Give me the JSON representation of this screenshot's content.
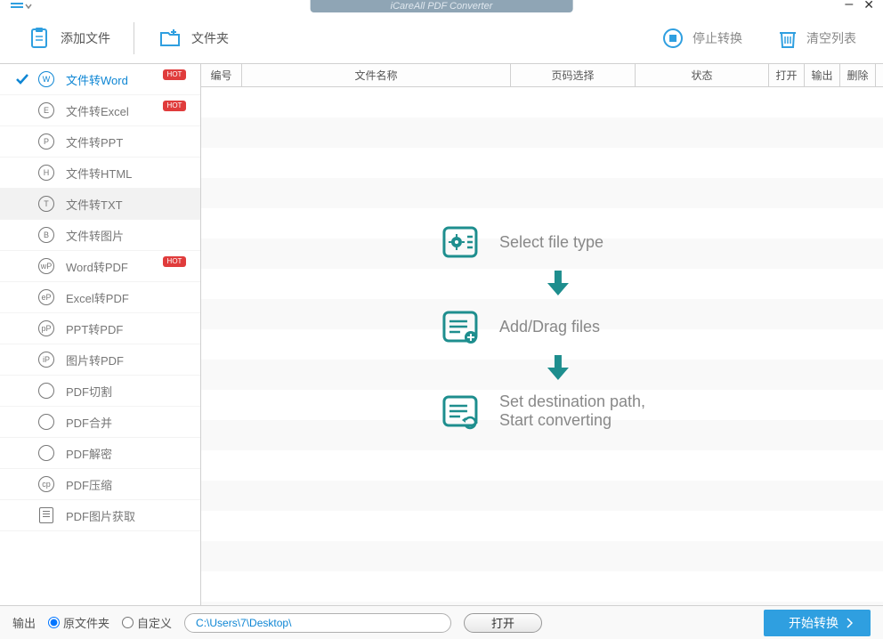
{
  "app": {
    "title": "iCareAll PDF Converter"
  },
  "toolbar": {
    "add_file": "添加文件",
    "add_folder": "文件夹",
    "stop": "停止转换",
    "clear": "清空列表"
  },
  "sidebar": {
    "items": [
      {
        "icon": "W",
        "label": "文件转Word",
        "hot": true,
        "active": true
      },
      {
        "icon": "E",
        "label": "文件转Excel",
        "hot": true
      },
      {
        "icon": "P",
        "label": "文件转PPT"
      },
      {
        "icon": "H",
        "label": "文件转HTML"
      },
      {
        "icon": "T",
        "label": "文件转TXT",
        "hover": true
      },
      {
        "icon": "B",
        "label": "文件转图片"
      },
      {
        "icon": "wP",
        "label": "Word转PDF",
        "hot": true
      },
      {
        "icon": "eP",
        "label": "Excel转PDF"
      },
      {
        "icon": "pP",
        "label": "PPT转PDF"
      },
      {
        "icon": "iP",
        "label": "图片转PDF"
      },
      {
        "icon": "cut",
        "label": "PDF切割"
      },
      {
        "icon": "mer",
        "label": "PDF合并"
      },
      {
        "icon": "dec",
        "label": "PDF解密"
      },
      {
        "icon": "cp",
        "label": "PDF压缩"
      },
      {
        "icon": "img",
        "label": "PDF图片获取"
      }
    ]
  },
  "table": {
    "columns": {
      "num": "编号",
      "name": "文件名称",
      "page": "页码选择",
      "status": "状态",
      "open": "打开",
      "out": "输出",
      "del": "删除"
    }
  },
  "placeholder": {
    "step1": "Select file type",
    "step2": "Add/Drag files",
    "step3a": "Set destination path,",
    "step3b": "Start converting"
  },
  "footer": {
    "output_label": "输出",
    "radio_src": "原文件夹",
    "radio_custom": "自定义",
    "path": "C:\\Users\\7\\Desktop\\",
    "open": "打开",
    "start": "开始转换"
  },
  "hot_label": "HOT"
}
